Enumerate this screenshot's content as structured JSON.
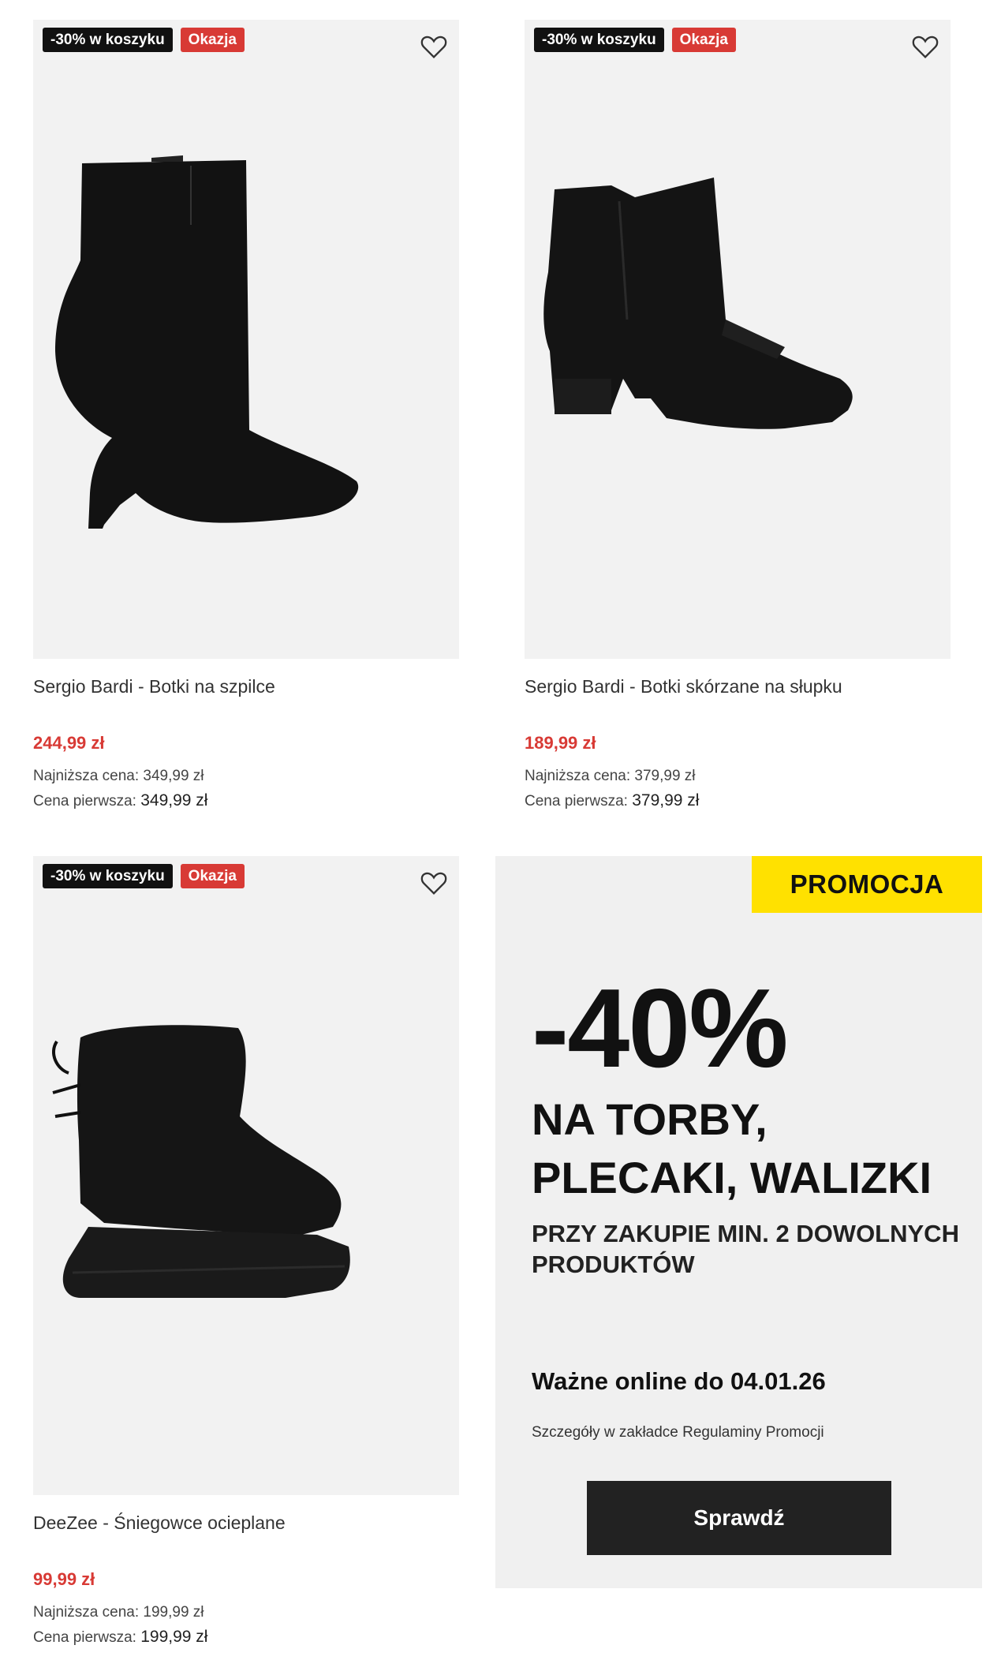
{
  "products": [
    {
      "badge_discount": "-30% w koszyku",
      "badge_deal": "Okazja",
      "title": "Sergio Bardi - Botki na szpilce",
      "price": "244,99 zł",
      "lowest_label": "Najniższa cena: 349,99 zł",
      "first_label": "Cena pierwsza:",
      "first_value": "349,99 zł"
    },
    {
      "badge_discount": "-30% w koszyku",
      "badge_deal": "Okazja",
      "title": "Sergio Bardi - Botki skórzane na słupku",
      "price": "189,99 zł",
      "lowest_label": "Najniższa cena: 379,99 zł",
      "first_label": "Cena pierwsza:",
      "first_value": "379,99 zł"
    },
    {
      "badge_discount": "-30% w koszyku",
      "badge_deal": "Okazja",
      "title": "DeeZee - Śniegowce ocieplane",
      "price": "99,99 zł",
      "lowest_label": "Najniższa cena: 199,99 zł",
      "first_label": "Cena pierwsza:",
      "first_value": "199,99 zł"
    }
  ],
  "promo": {
    "tag": "PROMOCJA",
    "discount": "-40%",
    "headline_1": "NA TORBY,",
    "headline_2": "PLECAKI, WALIZKI",
    "subline": "PRZY ZAKUPIE MIN. 2 DOWOLNYCH PRODUKTÓW",
    "validity": "Ważne online do 04.01.26",
    "details": "Szczegóły w zakładce Regulaminy Promocji",
    "button": "Sprawdź"
  },
  "icons": {
    "favorite": "heart-icon"
  },
  "colors": {
    "sale_red": "#d83a35",
    "promo_yellow": "#ffe100",
    "badge_dark": "#111111",
    "tile_bg": "#f2f2f2"
  }
}
